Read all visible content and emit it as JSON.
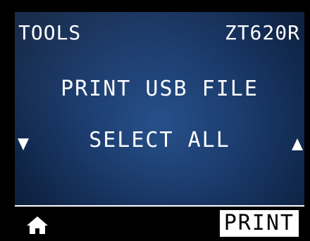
{
  "header": {
    "menu_title": "TOOLS",
    "model": "ZT620R"
  },
  "menu": {
    "item": "PRINT USB FILE",
    "selection": "SELECT ALL"
  },
  "navigation": {
    "left_arrow_icon": "triangle-down-icon",
    "right_arrow_icon": "triangle-up-icon"
  },
  "softkeys": {
    "left_icon": "home-icon",
    "right_label": "PRINT"
  },
  "colors": {
    "screen_center": "#27508a",
    "screen_edge": "#0a1a36",
    "text": "#ffffff",
    "softkey_background": "#000000",
    "softkey_highlight": "#ffffff"
  }
}
